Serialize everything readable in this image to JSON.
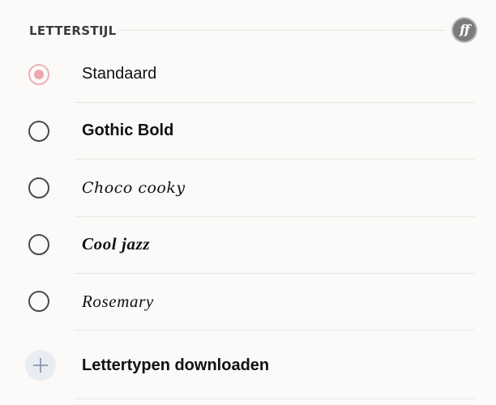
{
  "header": {
    "title": "LETTERSTIJL",
    "font_button_label": "ff",
    "font_button_icon": "font-style-icon"
  },
  "font_options": [
    {
      "label": "Standaard",
      "selected": true
    },
    {
      "label": "Gothic Bold",
      "selected": false
    },
    {
      "label": "Choco cooky",
      "selected": false
    },
    {
      "label": "Cool jazz",
      "selected": false
    },
    {
      "label": "Rosemary",
      "selected": false
    }
  ],
  "download": {
    "label": "Lettertypen downloaden",
    "icon": "plus-icon"
  },
  "colors": {
    "background": "#fbfaf9",
    "selected_radio": "#eda7ae",
    "add_circle": "#e9ecf1",
    "plus": "#8b97ad"
  }
}
